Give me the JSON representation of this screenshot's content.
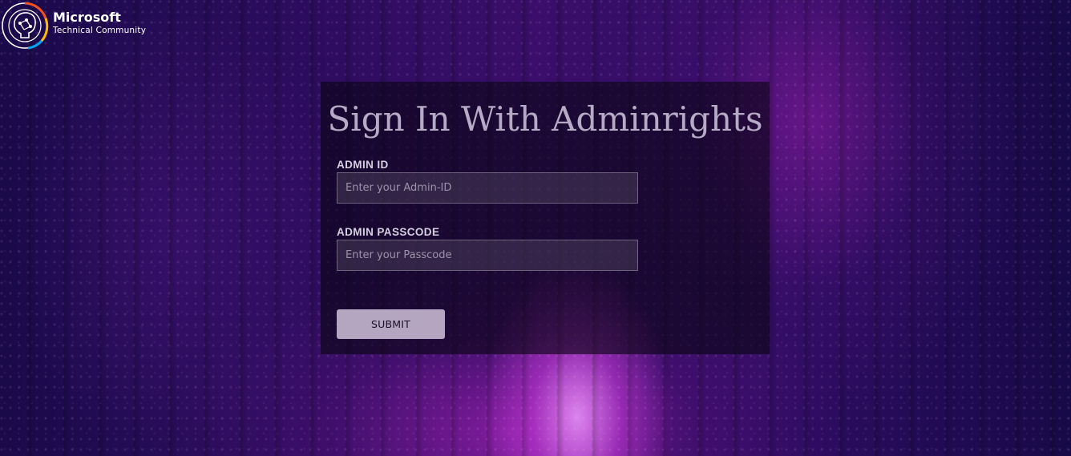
{
  "brand": {
    "logo_icon": "microsoft-community-emblem-icon",
    "title": "Microsoft",
    "subtitle": "Technical Community"
  },
  "login": {
    "heading": "Sign In With Adminrights",
    "admin_id": {
      "label": "ADMIN ID",
      "placeholder": "Enter your Admin-ID",
      "value": ""
    },
    "passcode": {
      "label": "ADMIN PASSCODE",
      "placeholder": "Enter your Passcode",
      "value": ""
    },
    "submit_label": "SUBMIT"
  },
  "colors": {
    "heading": "#b7aac7",
    "label": "#d6cfe2",
    "button_bg": "#d7c8e1",
    "panel_bg": "#0a0514"
  }
}
